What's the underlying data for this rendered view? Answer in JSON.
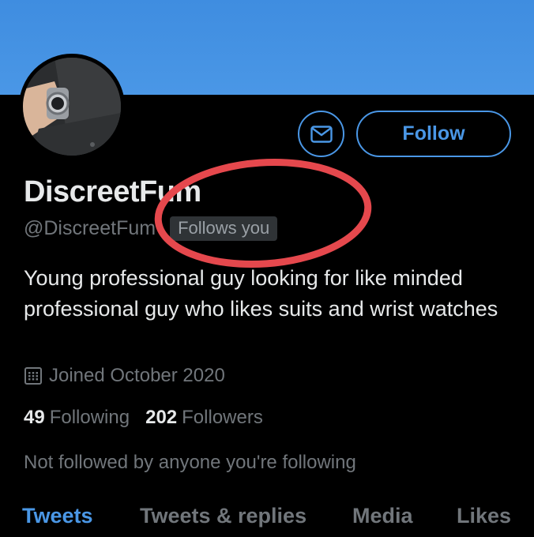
{
  "profile": {
    "display_name": "DiscreetFum",
    "handle": "@DiscreetFum",
    "follows_you_badge": "Follows you",
    "bio": "Young professional guy looking for like minded professional guy who likes suits and wrist watches",
    "joined": "Joined October 2020",
    "following_count": "49",
    "following_label": "Following",
    "followers_count": "202",
    "followers_label": "Followers",
    "mutuals_note": "Not followed by anyone you're following"
  },
  "actions": {
    "message_icon": "envelope-icon",
    "follow_label": "Follow"
  },
  "tabs": [
    {
      "label": "Tweets",
      "active": true
    },
    {
      "label": "Tweets & replies",
      "active": false
    },
    {
      "label": "Media",
      "active": false
    },
    {
      "label": "Likes",
      "active": false
    }
  ],
  "icons": {
    "joined": "calendar-icon"
  },
  "colors": {
    "accent": "#4a97e6",
    "banner": "#4a97e6",
    "text_primary": "#e7e9ea",
    "text_secondary": "#71767b",
    "annotation_circle": "#e5484d"
  }
}
